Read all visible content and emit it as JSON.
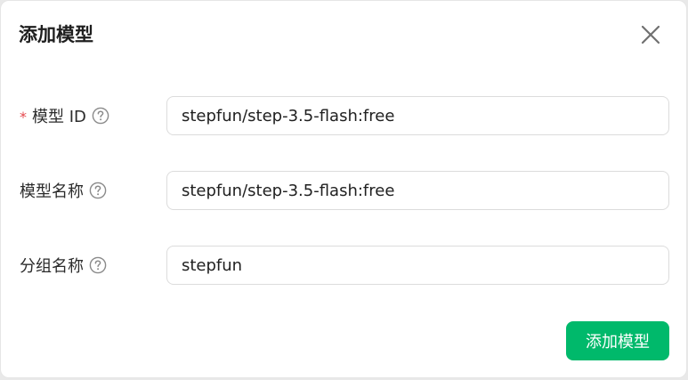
{
  "dialog": {
    "title": "添加模型",
    "close_icon": "close-icon"
  },
  "form": {
    "model_id": {
      "required_mark": "*",
      "label": "模型 ID",
      "help_icon": "question-circle-icon",
      "value": "stepfun/step-3.5-flash:free"
    },
    "model_name": {
      "label": "模型名称",
      "help_icon": "question-circle-icon",
      "value": "stepfun/step-3.5-flash:free"
    },
    "group_name": {
      "label": "分组名称",
      "help_icon": "question-circle-icon",
      "value": "stepfun"
    }
  },
  "actions": {
    "submit_label": "添加模型"
  },
  "colors": {
    "accent": "#00b96b",
    "required": "#e5484d"
  }
}
